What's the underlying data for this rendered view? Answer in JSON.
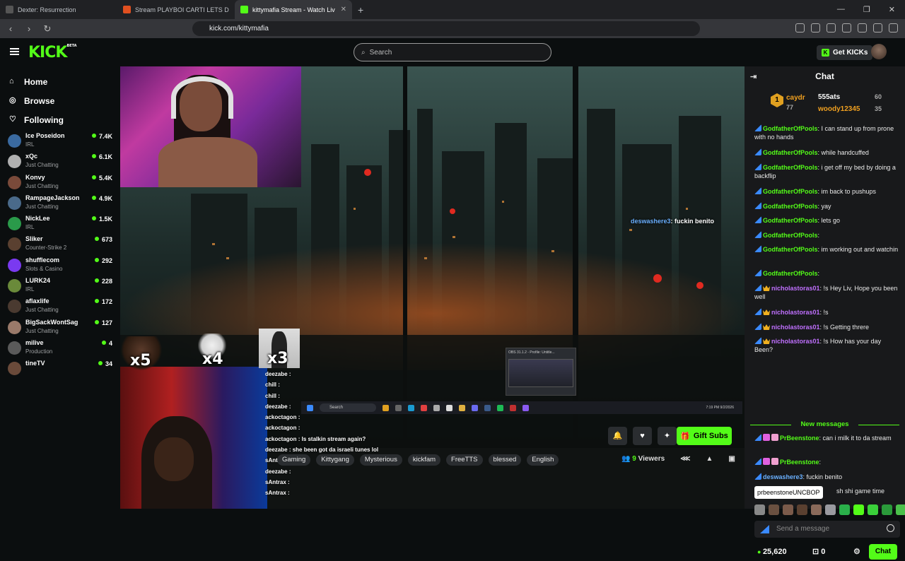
{
  "browser": {
    "tabs": [
      {
        "title": "Dexter: Resurrection",
        "color": "#555555"
      },
      {
        "title": "Stream PLAYBOI CARTI LETS DO IT G",
        "color": "#e05020"
      },
      {
        "title": "kittymafia Stream - Watch Liv",
        "color": "#53fc18"
      }
    ],
    "url": "kick.com/kittymafia"
  },
  "header": {
    "logo": "KICK",
    "logo_sup": "BETA",
    "search_placeholder": "Search",
    "get_kicks": "Get KICKs"
  },
  "sidebar": {
    "nav": [
      {
        "label": "Home",
        "icon": "home-icon"
      },
      {
        "label": "Browse",
        "icon": "compass-icon"
      },
      {
        "label": "Following",
        "icon": "heart-icon"
      }
    ],
    "channels": [
      {
        "name": "Ice Poseidon",
        "category": "IRL",
        "viewers": "7.4K",
        "color": "#3a6aa0"
      },
      {
        "name": "xQc",
        "category": "Just Chatting",
        "viewers": "6.1K",
        "color": "#b0b0b0"
      },
      {
        "name": "Konvy",
        "category": "Just Chatting",
        "viewers": "5.4K",
        "color": "#7a4a3a"
      },
      {
        "name": "RampageJackson",
        "category": "Just Chatting",
        "viewers": "4.9K",
        "color": "#4a6a8a"
      },
      {
        "name": "NickLee",
        "category": "IRL",
        "viewers": "1.5K",
        "color": "#2a9a4a"
      },
      {
        "name": "Sliker",
        "category": "Counter-Strike 2",
        "viewers": "673",
        "color": "#5a4030"
      },
      {
        "name": "shufflecom",
        "category": "Slots & Casino",
        "viewers": "292",
        "color": "#7a3af0"
      },
      {
        "name": "LURK24",
        "category": "IRL",
        "viewers": "228",
        "color": "#6a8a3a"
      },
      {
        "name": "aflaxlife",
        "category": "Just Chatting",
        "viewers": "172",
        "color": "#4a3a30"
      },
      {
        "name": "BigSackWontSag",
        "category": "Just Chatting",
        "viewers": "127",
        "color": "#9a7a6a"
      },
      {
        "name": "milive",
        "category": "Production",
        "viewers": "4",
        "color": "#5a5a5a"
      },
      {
        "name": "tineTV",
        "category": "",
        "viewers": "34",
        "color": "#6a4a3a"
      }
    ]
  },
  "video": {
    "emotes": [
      "x5",
      "x4",
      "x3"
    ],
    "overlay_chat": [
      {
        "user": "deezabe",
        "text": ":"
      },
      {
        "user": "chill",
        "text": ":"
      },
      {
        "user": "chill",
        "text": ":"
      },
      {
        "user": "deezabe",
        "text": ":"
      },
      {
        "user": "ackoctagon",
        "text": ":"
      },
      {
        "user": "ackoctagon",
        "text": ":"
      },
      {
        "user": "ackoctagon",
        "text": ": Is stalkin stream again?"
      },
      {
        "user": "deezabe",
        "text": ": she been got da israeli tunes lol"
      },
      {
        "user": "sAntrax",
        "text": ":"
      },
      {
        "user": "deezabe",
        "text": ":"
      },
      {
        "user": "sAntrax",
        "text": ":"
      },
      {
        "user": "sAntrax",
        "text": ":"
      }
    ],
    "overlay_msg_user": "deswashere3",
    "overlay_msg_text": ": fuckin benito",
    "obs_label": "OBS 31.1.2 - Profile: Untitle...",
    "taskbar_search": "Search",
    "taskbar_time": "7:19 PM",
    "taskbar_date": "9/2/2026"
  },
  "stream_info": {
    "tags": [
      "Gaming",
      "Kittygang",
      "Mysterious",
      "kickfam",
      "FreeTTS",
      "blessed",
      "English"
    ],
    "gift_subs": "Gift Subs",
    "viewers_count": "9",
    "viewers_label": "Viewers"
  },
  "chat": {
    "title": "Chat",
    "leaderboard": {
      "rank": "1",
      "first_user": "caydr",
      "first_value": "77",
      "second_user": "555ats",
      "second_value": "60",
      "third_user": "woody12345",
      "third_value": "35"
    },
    "messages": [
      {
        "user": "GodfatherOfPools",
        "text": ": I can stand up from prone with no hands"
      },
      {
        "user": "GodfatherOfPools",
        "text": ": while handcuffed"
      },
      {
        "user": "GodfatherOfPools",
        "text": ": i get off my bed by doing a backflip"
      },
      {
        "user": "GodfatherOfPools",
        "text": ": im back to pushups"
      },
      {
        "user": "GodfatherOfPools",
        "text": ": yay"
      },
      {
        "user": "GodfatherOfPools",
        "text": ": lets go"
      },
      {
        "user": "GodfatherOfPools",
        "text": ":"
      },
      {
        "user": "GodfatherOfPools",
        "text": ": im working out and watchin"
      },
      {
        "user": "GodfatherOfPools",
        "text": ":"
      },
      {
        "user": "nicholastoras01",
        "text": ": !s Hey Liv, Hope you been well"
      },
      {
        "user": "nicholastoras01",
        "text": ": !s"
      },
      {
        "user": "nicholastoras01",
        "text": ": !s Getting threre"
      },
      {
        "user": "nicholastoras01",
        "text": ": !s How has your day Been?"
      }
    ],
    "new_messages_label": "New messages",
    "new_msgs": [
      {
        "user": "PrBeenstone",
        "text": ": can i milk it to da stream"
      },
      {
        "user": "PrBeenstone",
        "text": ":"
      },
      {
        "user": "deswashere3",
        "text": ": fuckin benito"
      },
      {
        "user": "",
        "text": "sh shi game time"
      }
    ],
    "tooltip": "prbeenstoneUNCBOP",
    "input_placeholder": "Send a message",
    "points": "25,620",
    "gifts": "0",
    "send_label": "Chat"
  }
}
